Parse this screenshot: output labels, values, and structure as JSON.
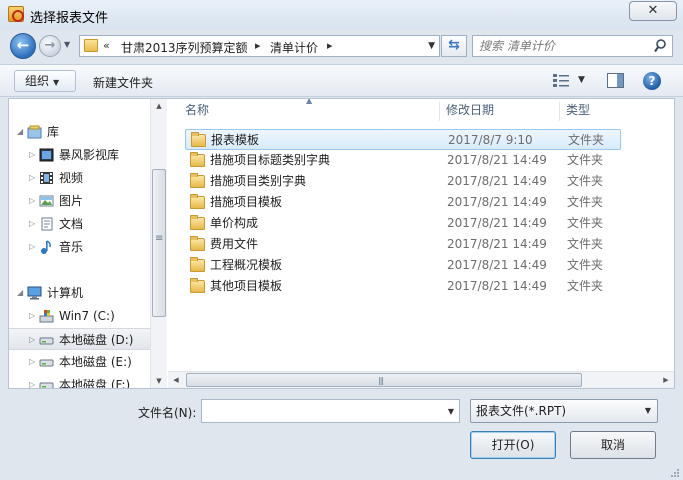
{
  "window": {
    "title": "选择报表文件",
    "close_label": "✕"
  },
  "address": {
    "overflow": "«",
    "crumbs": [
      "甘肃2013序列预算定额",
      "清单计价"
    ],
    "chevron": "▸"
  },
  "search": {
    "placeholder": "搜索 清单计价"
  },
  "toolbar": {
    "organize_label": "组织",
    "new_folder_label": "新建文件夹"
  },
  "sidebar": {
    "items": [
      {
        "label": "库",
        "icon": "library-icon",
        "level": 0
      },
      {
        "label": "暴风影视库",
        "icon": "video-library-icon",
        "level": 1
      },
      {
        "label": "视频",
        "icon": "video-icon",
        "level": 1
      },
      {
        "label": "图片",
        "icon": "pictures-icon",
        "level": 1
      },
      {
        "label": "文档",
        "icon": "documents-icon",
        "level": 1
      },
      {
        "label": "音乐",
        "icon": "music-icon",
        "level": 1
      },
      {
        "label": "计算机",
        "icon": "computer-icon",
        "level": 0
      },
      {
        "label": "Win7 (C:)",
        "icon": "system-drive-icon",
        "level": 1
      },
      {
        "label": "本地磁盘 (D:)",
        "icon": "drive-icon",
        "level": 1,
        "selected": true
      },
      {
        "label": "本地磁盘 (E:)",
        "icon": "drive-icon",
        "level": 1
      },
      {
        "label": "本地磁盘 (F:)",
        "icon": "drive-icon",
        "level": 1
      }
    ]
  },
  "filelist": {
    "columns": [
      "名称",
      "修改日期",
      "类型"
    ],
    "rows": [
      {
        "name": "报表模板",
        "date": "2017/8/7 9:10",
        "type": "文件夹",
        "selected": true
      },
      {
        "name": "措施项目标题类别字典",
        "date": "2017/8/21 14:49",
        "type": "文件夹"
      },
      {
        "name": "措施项目类别字典",
        "date": "2017/8/21 14:49",
        "type": "文件夹"
      },
      {
        "name": "措施项目模板",
        "date": "2017/8/21 14:49",
        "type": "文件夹"
      },
      {
        "name": "单价构成",
        "date": "2017/8/21 14:49",
        "type": "文件夹"
      },
      {
        "name": "费用文件",
        "date": "2017/8/21 14:49",
        "type": "文件夹"
      },
      {
        "name": "工程概况模板",
        "date": "2017/8/21 14:49",
        "type": "文件夹"
      },
      {
        "name": "其他项目模板",
        "date": "2017/8/21 14:49",
        "type": "文件夹"
      }
    ]
  },
  "footer": {
    "filename_label": "文件名(N):",
    "filename_value": "",
    "filetype_value": "报表文件(*.RPT)",
    "open_label": "打开(O)",
    "cancel_label": "取消"
  },
  "colors": {
    "accent": "#2d6fbd",
    "selection": "#d8ebfb",
    "folder": "#e8b94a"
  }
}
